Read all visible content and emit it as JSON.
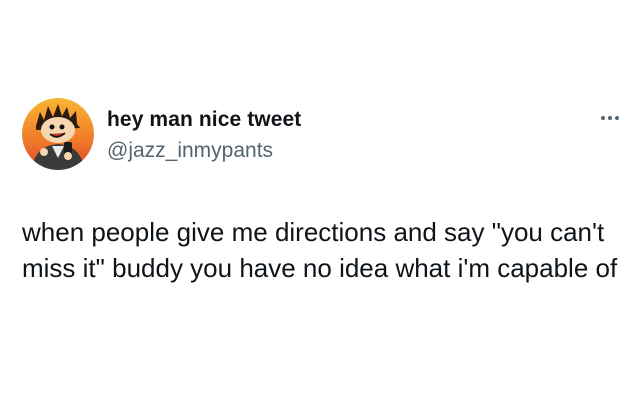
{
  "author": {
    "display_name": "hey man nice tweet",
    "handle": "@jazz_inmypants"
  },
  "tweet": {
    "text": "when people give me directions and say  \"you can't miss it\" buddy you have no idea what i'm capable of"
  },
  "icons": {
    "more": "more-options-icon",
    "avatar": "avatar-cartoon-boy"
  },
  "colors": {
    "text": "#0f1419",
    "secondary_text": "#536471",
    "background": "#ffffff",
    "avatar_sky_top": "#f5a623",
    "avatar_sky_bottom": "#e8542a"
  }
}
